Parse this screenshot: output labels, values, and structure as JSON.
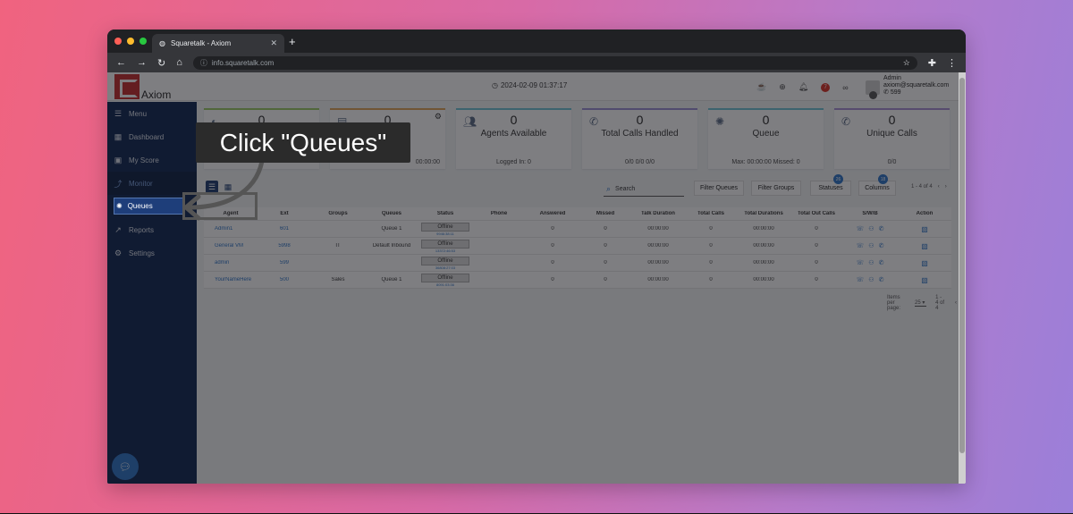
{
  "browser": {
    "tab_title": "Squaretalk - Axiom",
    "url": "info.squaretalk.com"
  },
  "header": {
    "logo_text": "Axiom",
    "datetime": "2024-02-09 01:37:17",
    "notification_count": "7",
    "user_name": "Admin",
    "user_email": "axiom@squaretalk.com",
    "user_ext": "599"
  },
  "sidebar": {
    "items": [
      {
        "label": "Menu",
        "icon": "hamburger-icon"
      },
      {
        "label": "Dashboard",
        "icon": "dashboard-icon"
      },
      {
        "label": "My Score",
        "icon": "score-icon"
      },
      {
        "label": "Monitor",
        "icon": "monitor-icon"
      },
      {
        "label": "Queues",
        "icon": "queues-icon"
      },
      {
        "label": "Reports",
        "icon": "reports-icon"
      },
      {
        "label": "Settings",
        "icon": "gear-icon"
      }
    ]
  },
  "cards": [
    {
      "value": "0",
      "title": "",
      "footer": ""
    },
    {
      "value": "0",
      "title": "",
      "footer": "00:00:00"
    },
    {
      "value": "0",
      "title": "Agents Available",
      "footer": "Logged In: 0"
    },
    {
      "value": "0",
      "title": "Total Calls Handled",
      "footer": "0/0   0/0   0/0"
    },
    {
      "value": "0",
      "title": "Queue",
      "footer": "Max:  00:00:00   Missed:  0"
    },
    {
      "value": "0",
      "title": "Unique Calls",
      "footer": "0/0"
    }
  ],
  "toolbar": {
    "search_placeholder": "Search",
    "filter_queues": "Filter Queues",
    "filter_groups": "Filter Groups",
    "statuses": "Statuses",
    "statuses_badge": "26",
    "columns": "Columns",
    "columns_badge": "18",
    "pager": "1 - 4 of 4"
  },
  "table": {
    "headers": [
      "Agent",
      "Ext",
      "Groups",
      "Queues",
      "Status",
      "Phone",
      "Answered",
      "Missed",
      "Talk Duration",
      "Total Calls",
      "Total Durations",
      "Total Out Calls",
      "S/W/B",
      "Action"
    ],
    "rows": [
      {
        "agent": "Admin1",
        "ext": "601",
        "groups": "",
        "queues": "Queue 1",
        "status": "Offline",
        "status_sub": "9946:38:11",
        "phone": "",
        "answered": "0",
        "missed": "0",
        "talk": "00:00:00",
        "total_calls": "0",
        "total_dur": "00:00:00",
        "out_calls": "0"
      },
      {
        "agent": "General VM",
        "ext": "5998",
        "groups": "IT",
        "queues": "Default Inbound",
        "status": "Offline",
        "status_sub": "13372:46:53",
        "phone": "",
        "answered": "0",
        "missed": "0",
        "talk": "00:00:00",
        "total_calls": "0",
        "total_dur": "00:00:00",
        "out_calls": "0"
      },
      {
        "agent": "admin",
        "ext": "599",
        "groups": "",
        "queues": "",
        "status": "Offline",
        "status_sub": "36808:27:03",
        "phone": "",
        "answered": "0",
        "missed": "0",
        "talk": "00:00:00",
        "total_calls": "0",
        "total_dur": "00:00:00",
        "out_calls": "0"
      },
      {
        "agent": "YourNameHere",
        "ext": "500",
        "groups": "Sales",
        "queues": "Queue 1",
        "status": "Offline",
        "status_sub": "8091:03:36",
        "phone": "",
        "answered": "0",
        "missed": "0",
        "talk": "00:00:00",
        "total_calls": "0",
        "total_dur": "00:00:00",
        "out_calls": "0"
      }
    ]
  },
  "footer_pager": {
    "items_per_page_label": "Items per page:",
    "items_per_page": "25",
    "range": "1 - 4 of 4"
  },
  "callout": {
    "text": "Click \"Queues\""
  },
  "colors": {
    "sidebar": "#0d2450",
    "accent": "#2c73c7",
    "brand": "#c52b2b"
  }
}
